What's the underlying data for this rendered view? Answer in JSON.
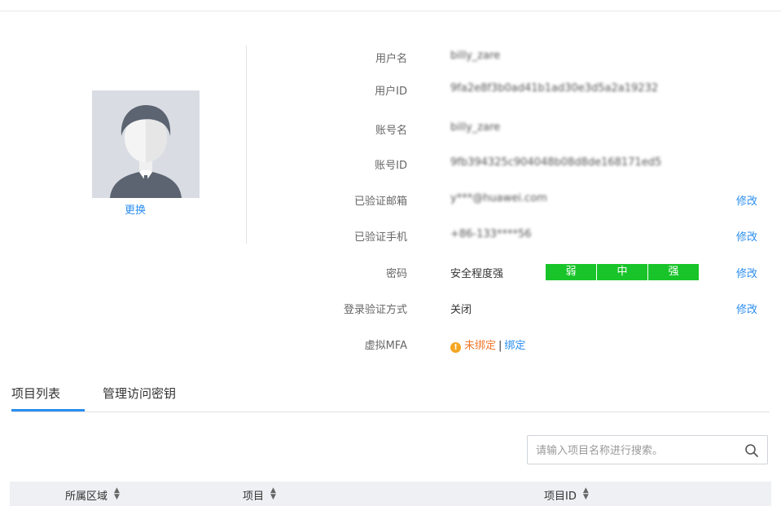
{
  "profile": {
    "change_label": "更换"
  },
  "info": {
    "username": {
      "label": "用户名",
      "value": "billy_zare"
    },
    "user_id": {
      "label": "用户ID",
      "value": "9fa2e8f3b0ad41b1ad30e3d5a2a19232"
    },
    "account_name": {
      "label": "账号名",
      "value": "billy_zare"
    },
    "account_id": {
      "label": "账号ID",
      "value": "9fb394325c904048b08d8de168171ed5"
    },
    "email": {
      "label": "已验证邮箱",
      "value": "y***@huawei.com",
      "edit": "修改"
    },
    "phone": {
      "label": "已验证手机",
      "value": "+86-133****56",
      "edit": "修改"
    },
    "password": {
      "label": "密码",
      "value": "安全程度强",
      "strength": [
        "弱",
        "中",
        "强"
      ],
      "edit": "修改"
    },
    "login_verify": {
      "label": "登录验证方式",
      "value": "关闭",
      "edit": "修改"
    },
    "mfa": {
      "label": "虚拟MFA",
      "status": "未绑定",
      "separator": "|",
      "bind": "绑定"
    }
  },
  "tabs": [
    {
      "label": "项目列表",
      "active": true
    },
    {
      "label": "管理访问密钥",
      "active": false
    }
  ],
  "search": {
    "placeholder": "请输入项目名称进行搜索。"
  },
  "table": {
    "columns": [
      {
        "label": "所属区域"
      },
      {
        "label": "项目"
      },
      {
        "label": "项目ID"
      }
    ]
  },
  "colors": {
    "accent": "#2b8ef0",
    "strength_green": "#19c42a",
    "warning": "#f0772b"
  }
}
